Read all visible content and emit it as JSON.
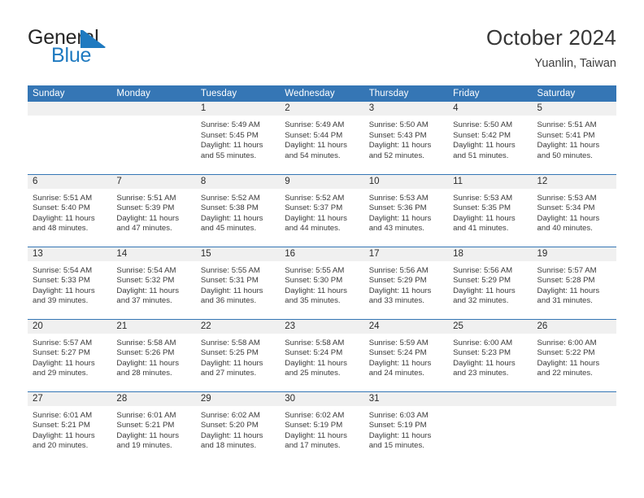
{
  "brand": {
    "word_one": "General",
    "word_two": "Blue",
    "triangle_icon": "triangle-icon",
    "accent_color": "#1f7ac0"
  },
  "header": {
    "title": "October 2024",
    "subtitle": "Yuanlin, Taiwan",
    "header_bg_color": "#3576b5",
    "daynum_bg_color": "#f0f0f0"
  },
  "calendar": {
    "weekday_headers": [
      "Sunday",
      "Monday",
      "Tuesday",
      "Wednesday",
      "Thursday",
      "Friday",
      "Saturday"
    ],
    "labels": {
      "sunrise": "Sunrise:",
      "sunset": "Sunset:",
      "daylight": "Daylight:"
    },
    "weeks": [
      [
        {
          "day": "",
          "sunrise": "",
          "sunset": "",
          "daylight_line1": "",
          "daylight_line2": "",
          "empty": true
        },
        {
          "day": "",
          "sunrise": "",
          "sunset": "",
          "daylight_line1": "",
          "daylight_line2": "",
          "empty": true
        },
        {
          "day": "1",
          "sunrise": "Sunrise: 5:49 AM",
          "sunset": "Sunset: 5:45 PM",
          "daylight_line1": "Daylight: 11 hours",
          "daylight_line2": "and 55 minutes."
        },
        {
          "day": "2",
          "sunrise": "Sunrise: 5:49 AM",
          "sunset": "Sunset: 5:44 PM",
          "daylight_line1": "Daylight: 11 hours",
          "daylight_line2": "and 54 minutes."
        },
        {
          "day": "3",
          "sunrise": "Sunrise: 5:50 AM",
          "sunset": "Sunset: 5:43 PM",
          "daylight_line1": "Daylight: 11 hours",
          "daylight_line2": "and 52 minutes."
        },
        {
          "day": "4",
          "sunrise": "Sunrise: 5:50 AM",
          "sunset": "Sunset: 5:42 PM",
          "daylight_line1": "Daylight: 11 hours",
          "daylight_line2": "and 51 minutes."
        },
        {
          "day": "5",
          "sunrise": "Sunrise: 5:51 AM",
          "sunset": "Sunset: 5:41 PM",
          "daylight_line1": "Daylight: 11 hours",
          "daylight_line2": "and 50 minutes."
        }
      ],
      [
        {
          "day": "6",
          "sunrise": "Sunrise: 5:51 AM",
          "sunset": "Sunset: 5:40 PM",
          "daylight_line1": "Daylight: 11 hours",
          "daylight_line2": "and 48 minutes."
        },
        {
          "day": "7",
          "sunrise": "Sunrise: 5:51 AM",
          "sunset": "Sunset: 5:39 PM",
          "daylight_line1": "Daylight: 11 hours",
          "daylight_line2": "and 47 minutes."
        },
        {
          "day": "8",
          "sunrise": "Sunrise: 5:52 AM",
          "sunset": "Sunset: 5:38 PM",
          "daylight_line1": "Daylight: 11 hours",
          "daylight_line2": "and 45 minutes."
        },
        {
          "day": "9",
          "sunrise": "Sunrise: 5:52 AM",
          "sunset": "Sunset: 5:37 PM",
          "daylight_line1": "Daylight: 11 hours",
          "daylight_line2": "and 44 minutes."
        },
        {
          "day": "10",
          "sunrise": "Sunrise: 5:53 AM",
          "sunset": "Sunset: 5:36 PM",
          "daylight_line1": "Daylight: 11 hours",
          "daylight_line2": "and 43 minutes."
        },
        {
          "day": "11",
          "sunrise": "Sunrise: 5:53 AM",
          "sunset": "Sunset: 5:35 PM",
          "daylight_line1": "Daylight: 11 hours",
          "daylight_line2": "and 41 minutes."
        },
        {
          "day": "12",
          "sunrise": "Sunrise: 5:53 AM",
          "sunset": "Sunset: 5:34 PM",
          "daylight_line1": "Daylight: 11 hours",
          "daylight_line2": "and 40 minutes."
        }
      ],
      [
        {
          "day": "13",
          "sunrise": "Sunrise: 5:54 AM",
          "sunset": "Sunset: 5:33 PM",
          "daylight_line1": "Daylight: 11 hours",
          "daylight_line2": "and 39 minutes."
        },
        {
          "day": "14",
          "sunrise": "Sunrise: 5:54 AM",
          "sunset": "Sunset: 5:32 PM",
          "daylight_line1": "Daylight: 11 hours",
          "daylight_line2": "and 37 minutes."
        },
        {
          "day": "15",
          "sunrise": "Sunrise: 5:55 AM",
          "sunset": "Sunset: 5:31 PM",
          "daylight_line1": "Daylight: 11 hours",
          "daylight_line2": "and 36 minutes."
        },
        {
          "day": "16",
          "sunrise": "Sunrise: 5:55 AM",
          "sunset": "Sunset: 5:30 PM",
          "daylight_line1": "Daylight: 11 hours",
          "daylight_line2": "and 35 minutes."
        },
        {
          "day": "17",
          "sunrise": "Sunrise: 5:56 AM",
          "sunset": "Sunset: 5:29 PM",
          "daylight_line1": "Daylight: 11 hours",
          "daylight_line2": "and 33 minutes."
        },
        {
          "day": "18",
          "sunrise": "Sunrise: 5:56 AM",
          "sunset": "Sunset: 5:29 PM",
          "daylight_line1": "Daylight: 11 hours",
          "daylight_line2": "and 32 minutes."
        },
        {
          "day": "19",
          "sunrise": "Sunrise: 5:57 AM",
          "sunset": "Sunset: 5:28 PM",
          "daylight_line1": "Daylight: 11 hours",
          "daylight_line2": "and 31 minutes."
        }
      ],
      [
        {
          "day": "20",
          "sunrise": "Sunrise: 5:57 AM",
          "sunset": "Sunset: 5:27 PM",
          "daylight_line1": "Daylight: 11 hours",
          "daylight_line2": "and 29 minutes."
        },
        {
          "day": "21",
          "sunrise": "Sunrise: 5:58 AM",
          "sunset": "Sunset: 5:26 PM",
          "daylight_line1": "Daylight: 11 hours",
          "daylight_line2": "and 28 minutes."
        },
        {
          "day": "22",
          "sunrise": "Sunrise: 5:58 AM",
          "sunset": "Sunset: 5:25 PM",
          "daylight_line1": "Daylight: 11 hours",
          "daylight_line2": "and 27 minutes."
        },
        {
          "day": "23",
          "sunrise": "Sunrise: 5:58 AM",
          "sunset": "Sunset: 5:24 PM",
          "daylight_line1": "Daylight: 11 hours",
          "daylight_line2": "and 25 minutes."
        },
        {
          "day": "24",
          "sunrise": "Sunrise: 5:59 AM",
          "sunset": "Sunset: 5:24 PM",
          "daylight_line1": "Daylight: 11 hours",
          "daylight_line2": "and 24 minutes."
        },
        {
          "day": "25",
          "sunrise": "Sunrise: 6:00 AM",
          "sunset": "Sunset: 5:23 PM",
          "daylight_line1": "Daylight: 11 hours",
          "daylight_line2": "and 23 minutes."
        },
        {
          "day": "26",
          "sunrise": "Sunrise: 6:00 AM",
          "sunset": "Sunset: 5:22 PM",
          "daylight_line1": "Daylight: 11 hours",
          "daylight_line2": "and 22 minutes."
        }
      ],
      [
        {
          "day": "27",
          "sunrise": "Sunrise: 6:01 AM",
          "sunset": "Sunset: 5:21 PM",
          "daylight_line1": "Daylight: 11 hours",
          "daylight_line2": "and 20 minutes."
        },
        {
          "day": "28",
          "sunrise": "Sunrise: 6:01 AM",
          "sunset": "Sunset: 5:21 PM",
          "daylight_line1": "Daylight: 11 hours",
          "daylight_line2": "and 19 minutes."
        },
        {
          "day": "29",
          "sunrise": "Sunrise: 6:02 AM",
          "sunset": "Sunset: 5:20 PM",
          "daylight_line1": "Daylight: 11 hours",
          "daylight_line2": "and 18 minutes."
        },
        {
          "day": "30",
          "sunrise": "Sunrise: 6:02 AM",
          "sunset": "Sunset: 5:19 PM",
          "daylight_line1": "Daylight: 11 hours",
          "daylight_line2": "and 17 minutes."
        },
        {
          "day": "31",
          "sunrise": "Sunrise: 6:03 AM",
          "sunset": "Sunset: 5:19 PM",
          "daylight_line1": "Daylight: 11 hours",
          "daylight_line2": "and 15 minutes."
        },
        {
          "day": "",
          "sunrise": "",
          "sunset": "",
          "daylight_line1": "",
          "daylight_line2": "",
          "empty": true
        },
        {
          "day": "",
          "sunrise": "",
          "sunset": "",
          "daylight_line1": "",
          "daylight_line2": "",
          "empty": true
        }
      ]
    ]
  }
}
